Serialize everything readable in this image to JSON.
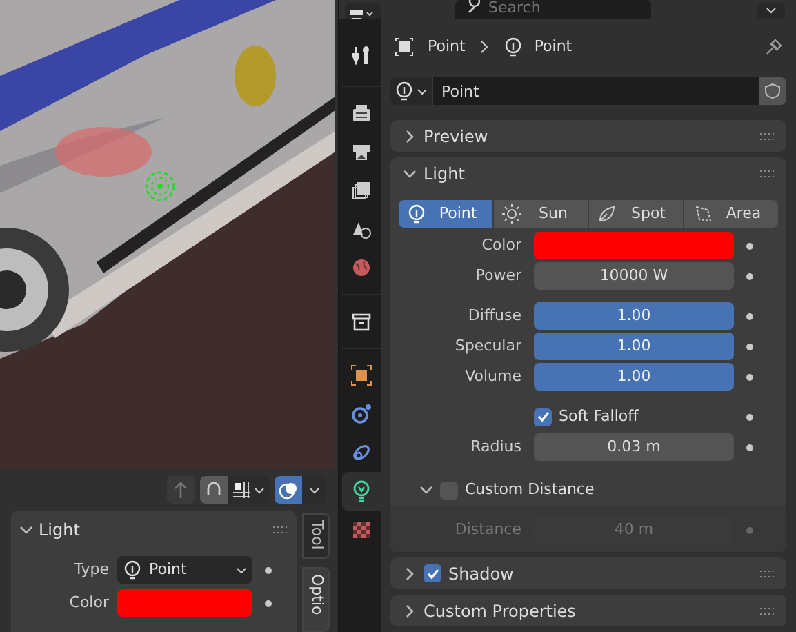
{
  "viewport": {
    "kind": "picture"
  },
  "viewport_header": {
    "toggles": [
      {
        "kind": "gizmo",
        "on": false
      },
      {
        "kind": "snap",
        "on": true
      },
      {
        "kind": "overlay",
        "on": true
      }
    ]
  },
  "sidebar_panel": {
    "title": "Light",
    "expanded": true,
    "rows": [
      {
        "label": "Type",
        "kind": "dropdown",
        "value": "Point"
      },
      {
        "label": "Color",
        "kind": "color",
        "color": "#ff0000"
      }
    ]
  },
  "sidebar_tabs": [
    {
      "label": "Tool",
      "selected": false
    },
    {
      "label": "Optio",
      "selected": true
    }
  ],
  "search": {
    "placeholder": "Search"
  },
  "property_tab_groups": [
    [
      {
        "kind": "tool",
        "selected": false
      }
    ],
    [
      {
        "kind": "render",
        "selected": false
      },
      {
        "kind": "output",
        "selected": false
      },
      {
        "kind": "view_layer",
        "selected": false
      },
      {
        "kind": "scene",
        "selected": false
      },
      {
        "kind": "world",
        "selected": false
      }
    ],
    [
      {
        "kind": "collection",
        "selected": false
      }
    ],
    [
      {
        "kind": "object",
        "selected": false
      },
      {
        "kind": "physics",
        "selected": false
      },
      {
        "kind": "constraints",
        "selected": false
      },
      {
        "kind": "light_data",
        "selected": true
      },
      {
        "kind": "texture",
        "selected": false
      }
    ]
  ],
  "breadcrumb": [
    "Point",
    "Point"
  ],
  "datablock": {
    "name": "Point"
  },
  "panels": [
    {
      "kind": "plain",
      "title": "Preview",
      "expanded": false
    },
    {
      "kind": "light",
      "title": "Light",
      "expanded": true,
      "light_types": [
        {
          "label": "Point",
          "selected": true
        },
        {
          "label": "Sun",
          "selected": false
        },
        {
          "label": "Spot",
          "selected": false
        },
        {
          "label": "Area",
          "selected": false
        }
      ],
      "row_groups": [
        [
          {
            "label": "Color",
            "kind": "color",
            "color": "#ff0000"
          },
          {
            "label": "Power",
            "kind": "value",
            "value": "10000 W",
            "disabled": false
          }
        ],
        [
          {
            "label": "Diffuse",
            "kind": "slider",
            "value": "1.00",
            "level": 1
          },
          {
            "label": "Specular",
            "kind": "slider",
            "value": "1.00",
            "level": 1
          },
          {
            "label": "Volume",
            "kind": "slider",
            "value": "1.00",
            "level": 1
          }
        ],
        [
          {
            "label": "Soft Falloff",
            "kind": "checkbox",
            "checked": true
          },
          {
            "label": "Radius",
            "kind": "value",
            "value": "0.03 m",
            "disabled": false
          }
        ]
      ],
      "subpanel": {
        "title": "Custom Distance",
        "expanded": true,
        "checked": false,
        "rows": [
          {
            "label": "Distance",
            "kind": "value",
            "value": "40 m",
            "disabled": true
          }
        ]
      }
    },
    {
      "kind": "checkbox",
      "title": "Shadow",
      "expanded": false,
      "checked": true
    },
    {
      "kind": "plain",
      "title": "Custom Properties",
      "expanded": false
    }
  ]
}
